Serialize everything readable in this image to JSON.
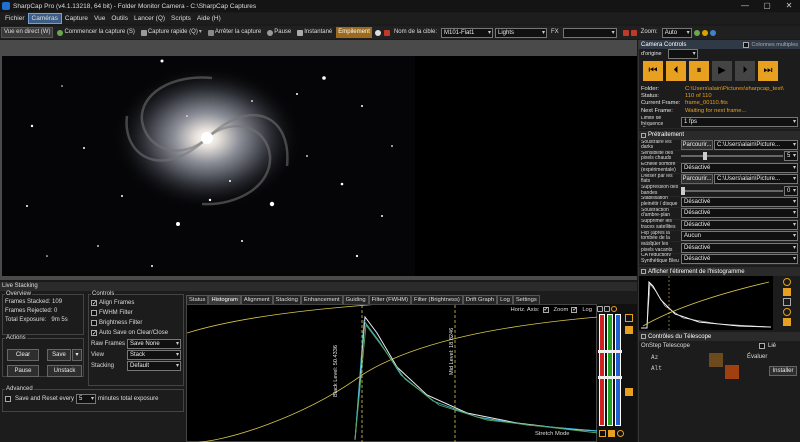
{
  "window": {
    "title": "SharpCap Pro (v4.1.13218, 64 bit) - Folder Monitor Camera - C:\\SharpCap Captures",
    "controls": [
      "—",
      "▢",
      "✕"
    ]
  },
  "menu": [
    "Fichier",
    "Caméras",
    "Capture",
    "Vue",
    "Outils",
    "Lancer (Q)",
    "Scripts",
    "Aide (H)"
  ],
  "toolbar": {
    "live_view": "Vue en direct (W)",
    "start_capture": "Commencer la capture (S)",
    "quick_capture": "Capture rapide (Q)",
    "stop_capture": "Arrêter la capture",
    "pause": "Pause",
    "snapshot": "Instantané",
    "stack": "Empilement",
    "target_label": "Nom de la cible:",
    "target_value": "M101-Flat1",
    "frame_type": "Lights",
    "fx_label": "FX",
    "zoom_label": "Zoom:",
    "zoom_value": "Auto"
  },
  "camera_controls": {
    "title": "Camera Controls",
    "multi_columns": "Colonnes multiples",
    "origin": "d'origine",
    "folder_label": "Folder:",
    "folder_value": "C:\\Users\\alain\\Pictures\\sharpcap_test\\",
    "status_label": "Status:",
    "status_value": "110 of 110",
    "current_label": "Current Frame:",
    "current_value": "frame_00110.fits",
    "next_label": "Next Frame:",
    "next_value": "Waiting for next frame...",
    "fps_label": "Limite de fréquence d'images",
    "fps_value": "1 fps"
  },
  "preprocessing": {
    "title": "Prétraitement",
    "browse": "Parcourir...",
    "rows": [
      {
        "label": "Soustraire les darks",
        "value": "C:\\Users\\alain\\Picture..."
      },
      {
        "label": "Sensibilité des pixels chauds",
        "value": "5"
      },
      {
        "label": "Échelle sombre (expérimentale)",
        "value": "Désactivé"
      },
      {
        "label": "Diviser par les flats",
        "value": "C:\\Users\\alain\\Picture..."
      },
      {
        "label": "Suppression des bandes",
        "value": "0"
      },
      {
        "label": "Stabilisation pleinétir / disque",
        "value": "Désactivé"
      },
      {
        "label": "Soustraction d'ambre-plan",
        "value": "Désactivé"
      },
      {
        "label": "Supprimer les traces satellites",
        "value": "Désactivé"
      },
      {
        "label": "Flip (après la tombée de la prédi-tion)",
        "value": "Aucun"
      },
      {
        "label": "Masquer les pixels vacants",
        "value": "Désactivé"
      },
      {
        "label": "CA réduction/ Synthétique Bleu",
        "value": "Désactivé"
      }
    ]
  },
  "histogram_panel": {
    "title": "Afficher l'étirement de l'histogramme"
  },
  "telescope": {
    "title": "Contrôles du Télescope",
    "device": "OnStep Telescope",
    "live": "Lié",
    "ra_label": "Az",
    "alt_label": "Alt",
    "evaluate": "Évaluer",
    "install": "Installer"
  },
  "live_stacking": {
    "title": "Live Stacking",
    "overview": {
      "legend": "Overview",
      "frames_stacked_label": "Frames Stacked:",
      "frames_stacked_value": "109",
      "frames_rejected_label": "Frames Rejected:",
      "frames_rejected_value": "0",
      "total_exposure_label": "Total Exposure:",
      "total_exposure_value": "9m 5s"
    },
    "actions": {
      "legend": "Actions",
      "clear": "Clear",
      "save": "Save",
      "pause": "Pause",
      "unstack": "Unstack"
    },
    "advanced": {
      "legend": "Advanced",
      "save_reset": "Save and Reset every",
      "minutes": "5",
      "minutes_suffix": "minutes total exposure"
    },
    "controls": {
      "legend": "Controls",
      "align_frames": "Align Frames",
      "fwhm_filter": "FWHM Filter",
      "brightness_filter": "Brightness Filter",
      "auto_save": "Auto Save on Clear/Close",
      "raw_frames_label": "Raw Frames",
      "raw_frames_value": "Save None",
      "view_label": "View",
      "view_value": "Stack",
      "stacking_label": "Stacking",
      "stacking_value": "Default"
    },
    "tabs": [
      "Status",
      "Histogram",
      "Alignment",
      "Stacking",
      "Enhancement",
      "Guiding",
      "Filter (FWHM)",
      "Filter (Brightness)",
      "Drift Graph",
      "Log",
      "Settings"
    ],
    "histogram": {
      "horiz_axis": "Horiz. Axis:",
      "zoom": "Zoom",
      "log": "Log",
      "black_level": "Black Level: 50.4336",
      "mid_level": "Mid Level: 18.8246",
      "stretch_mode": "Stretch Mode"
    }
  }
}
